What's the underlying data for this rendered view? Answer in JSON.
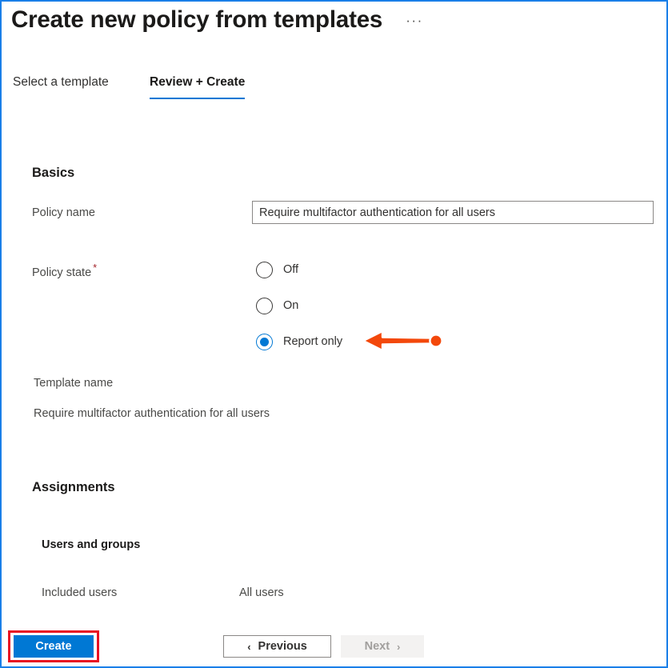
{
  "header": {
    "title": "Create new policy from templates",
    "more_menu": "···"
  },
  "tabs": [
    {
      "label": "Select a template",
      "active": false
    },
    {
      "label": "Review + Create",
      "active": true
    }
  ],
  "basics": {
    "heading": "Basics",
    "policy_name_label": "Policy name",
    "policy_name_value": "Require multifactor authentication for all users",
    "policy_name_placeholder": "",
    "policy_state_label": "Policy state",
    "policy_state_required_mark": "*",
    "policy_state_options": [
      {
        "label": "Off",
        "selected": false
      },
      {
        "label": "On",
        "selected": false
      },
      {
        "label": "Report only",
        "selected": true
      }
    ],
    "template_name_label": "Template name",
    "template_name_value": "Require multifactor authentication for all users"
  },
  "assignments": {
    "heading": "Assignments",
    "users_and_groups_heading": "Users and groups",
    "included_users_label": "Included users",
    "included_users_value": "All users"
  },
  "footer": {
    "create_label": "Create",
    "previous_label": "Previous",
    "next_label": "Next",
    "previous_chevron": "‹",
    "next_chevron": "›"
  },
  "annotation": {
    "arrow_color": "#f3480b",
    "arrow_outline": "#ffffff",
    "highlight_color": "#e81123",
    "points_to": "Report only"
  },
  "colors": {
    "window_border": "#1a7fe8",
    "accent": "#0078d4",
    "required_star": "#a4262c",
    "text_primary": "#1b1a19",
    "text_secondary": "#4a4a48",
    "disabled_text": "#a19f9d"
  }
}
